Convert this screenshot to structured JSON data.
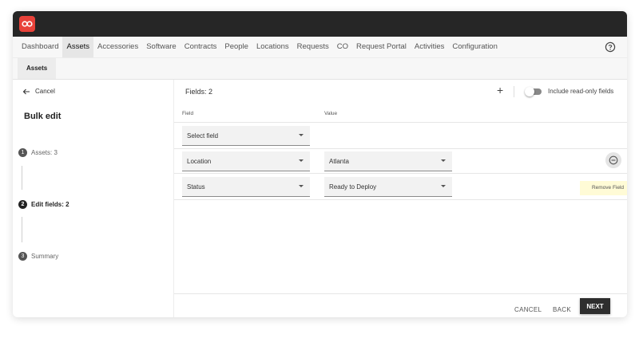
{
  "nav": {
    "items": [
      "Dashboard",
      "Assets",
      "Accessories",
      "Software",
      "Contracts",
      "People",
      "Locations",
      "Requests",
      "CO",
      "Request Portal",
      "Activities",
      "Configuration"
    ],
    "active": "Assets"
  },
  "subnav": {
    "tab": "Assets"
  },
  "left": {
    "cancel_label": "Cancel",
    "title": "Bulk edit",
    "steps": [
      {
        "num": "1",
        "label": "Assets: 3"
      },
      {
        "num": "2",
        "label": "Edit fields: 2"
      },
      {
        "num": "3",
        "label": "Summary"
      }
    ]
  },
  "fields": {
    "header": "Fields: 2",
    "add_symbol": "+",
    "toggle_label": "Include read-only fields",
    "col_field": "Field",
    "col_value": "Value",
    "placeholder_select": "Select field",
    "rows": [
      {
        "field": "Location",
        "value": "Atlanta"
      },
      {
        "field": "Status",
        "value": "Ready to Deploy"
      }
    ],
    "tooltip": "Remove Field"
  },
  "footer": {
    "cancel": "CANCEL",
    "back": "BACK",
    "next": "NEXT"
  },
  "colors": {
    "brand": "#e8423a",
    "topbar": "#262626",
    "primary_button": "#2e2e2e"
  }
}
